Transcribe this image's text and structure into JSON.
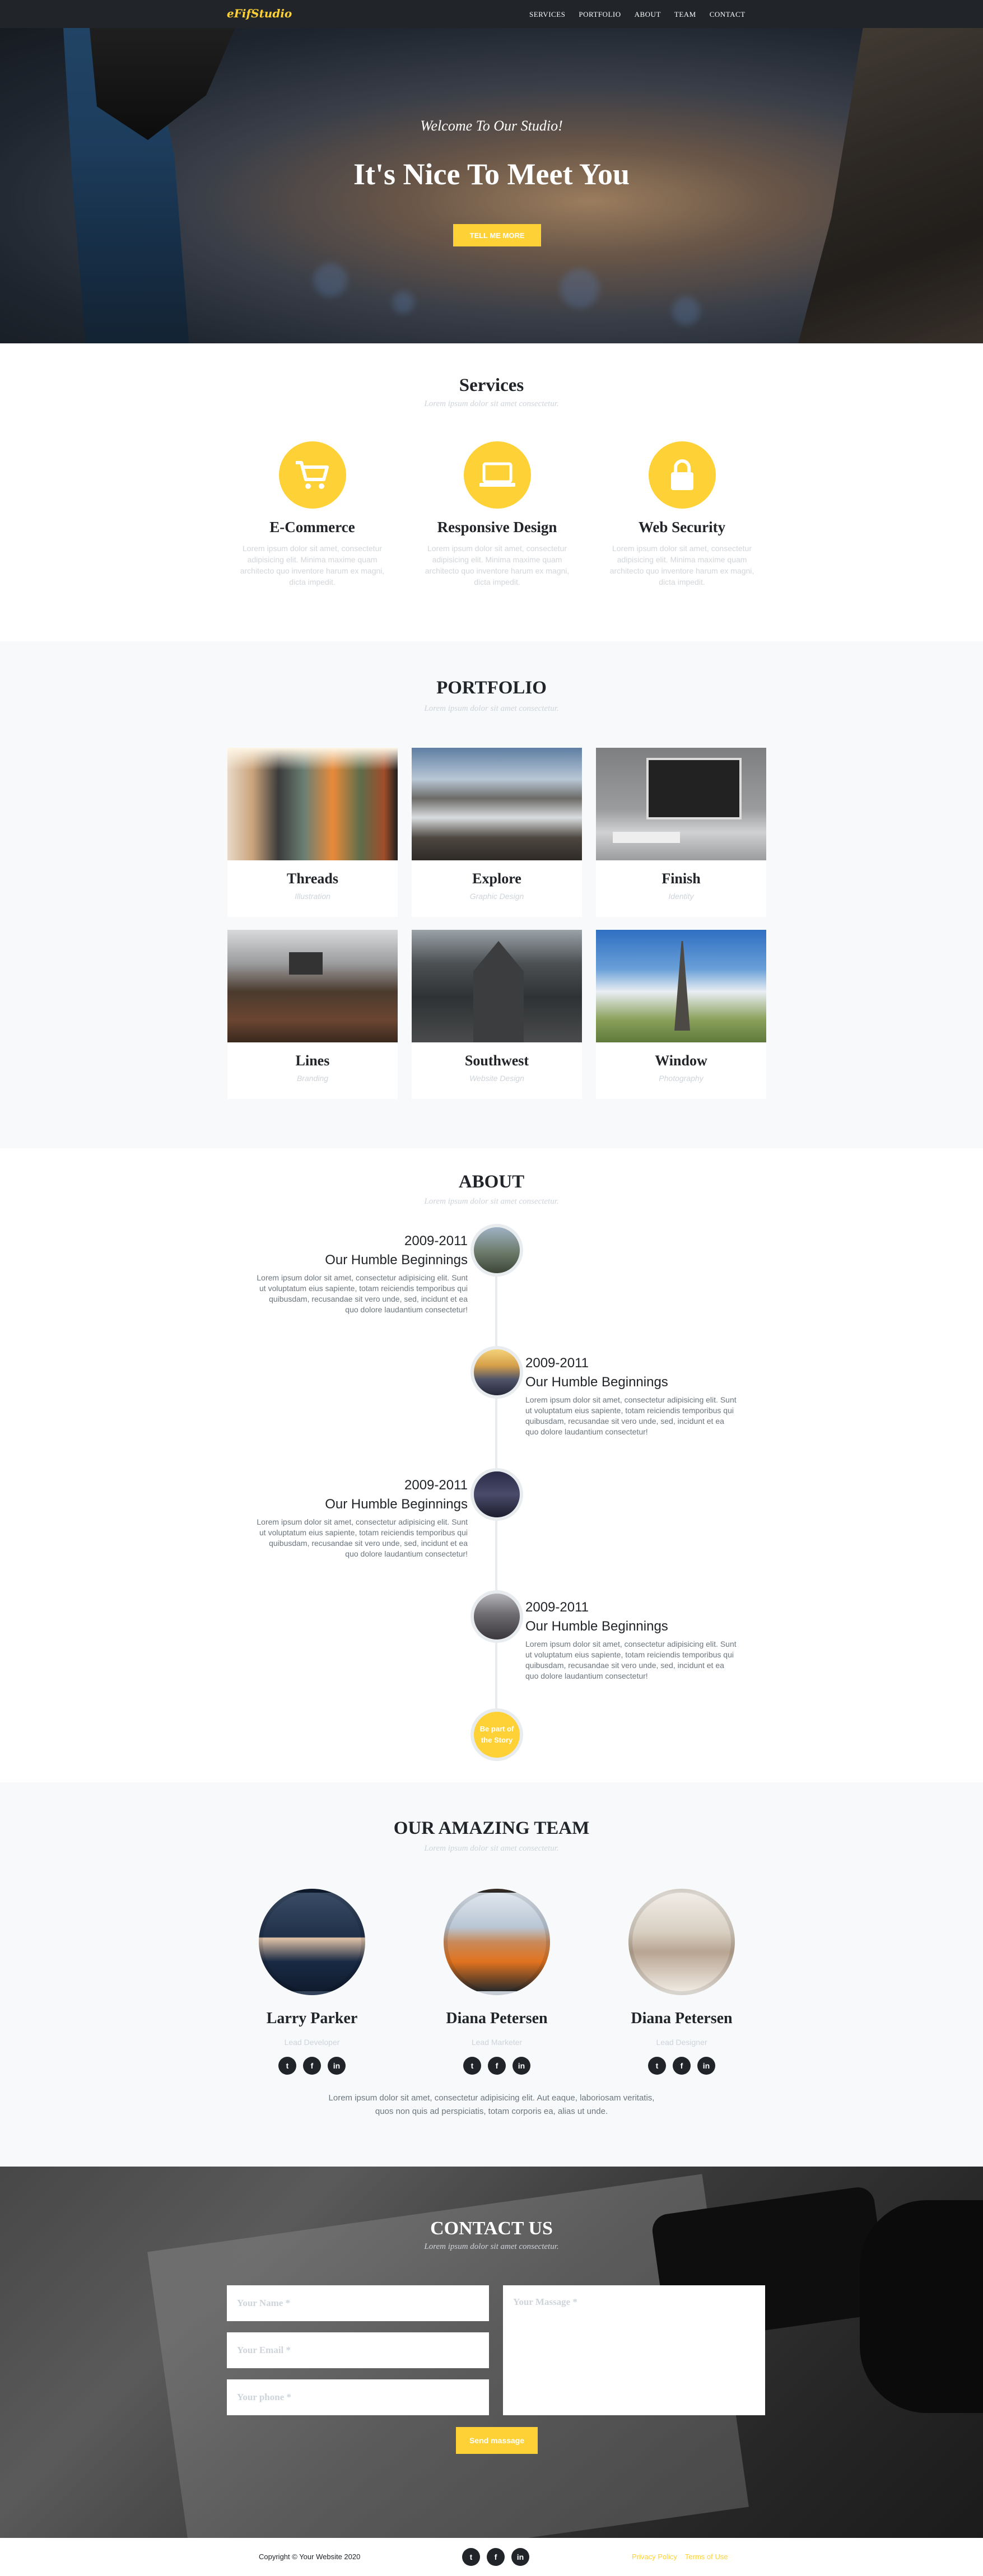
{
  "nav": {
    "brand": "eFifStudio",
    "items": [
      "SERVICES",
      "PORTFOLIO",
      "ABOUT",
      "TEAM",
      "CONTACT"
    ]
  },
  "hero": {
    "subtitle": "Welcome To Our Studio!",
    "title": "It's Nice To Meet You",
    "button": "TELL ME MORE"
  },
  "services": {
    "title": "Services",
    "subtitle": "Lorem ipsum dolor sit amet consectetur.",
    "items": [
      {
        "icon": "shopping-cart-icon",
        "title": "E-Commerce",
        "text": "Lorem ipsum dolor sit amet, consectetur adipisicing elit. Minima maxime quam architecto quo inventore harum ex magni, dicta impedit."
      },
      {
        "icon": "laptop-icon",
        "title": "Responsive Design",
        "text": "Lorem ipsum dolor sit amet, consectetur adipisicing elit. Minima maxime quam architecto quo inventore harum ex magni, dicta impedit."
      },
      {
        "icon": "lock-icon",
        "title": "Web Security",
        "text": "Lorem ipsum dolor sit amet, consectetur adipisicing elit. Minima maxime quam architecto quo inventore harum ex magni, dicta impedit."
      }
    ]
  },
  "portfolio": {
    "title": "PORTFOLIO",
    "subtitle": "Lorem ipsum dolor sit amet consectetur.",
    "items": [
      {
        "title": "Threads",
        "category": "Illustration"
      },
      {
        "title": "Explore",
        "category": "Graphic Design"
      },
      {
        "title": "Finish",
        "category": "Identity"
      },
      {
        "title": "Lines",
        "category": "Branding"
      },
      {
        "title": "Southwest",
        "category": "Website Design"
      },
      {
        "title": "Window",
        "category": "Photography"
      }
    ]
  },
  "about": {
    "title": "ABOUT",
    "subtitle": "Lorem ipsum dolor sit amet consectetur.",
    "items": [
      {
        "year": "2009-2011",
        "heading": "Our Humble Beginnings",
        "text": "Lorem ipsum dolor sit amet, consectetur adipisicing elit. Sunt ut voluptatum eius sapiente, totam reiciendis temporibus qui quibusdam, recusandae sit vero unde, sed, incidunt et ea quo dolore laudantium consectetur!"
      },
      {
        "year": "2009-2011",
        "heading": "Our Humble Beginnings",
        "text": "Lorem ipsum dolor sit amet, consectetur adipisicing elit. Sunt ut voluptatum eius sapiente, totam reiciendis temporibus qui quibusdam, recusandae sit vero unde, sed, incidunt et ea quo dolore laudantium consectetur!"
      },
      {
        "year": "2009-2011",
        "heading": "Our Humble Beginnings",
        "text": "Lorem ipsum dolor sit amet, consectetur adipisicing elit. Sunt ut voluptatum eius sapiente, totam reiciendis temporibus qui quibusdam, recusandae sit vero unde, sed, incidunt et ea quo dolore laudantium consectetur!"
      },
      {
        "year": "2009-2011",
        "heading": "Our Humble Beginnings",
        "text": "Lorem ipsum dolor sit amet, consectetur adipisicing elit. Sunt ut voluptatum eius sapiente, totam reiciendis temporibus qui quibusdam, recusandae sit vero unde, sed, incidunt et ea quo dolore laudantium consectetur!"
      }
    ],
    "story": "Be part of the Story"
  },
  "team": {
    "title": "OUR AMAZING TEAM",
    "subtitle": "Lorem ipsum dolor sit amet consectetur.",
    "members": [
      {
        "name": "Larry Parker",
        "role": "Lead Developer"
      },
      {
        "name": "Diana Petersen",
        "role": "Lead Marketer"
      },
      {
        "name": "Diana Petersen",
        "role": "Lead Designer"
      }
    ],
    "description": "Lorem ipsum dolor sit amet, consectetur adipisicing elit. Aut eaque, laboriosam veritatis, quos non quis ad perspiciatis, totam corporis ea, alias ut unde."
  },
  "contact": {
    "title": "CONTACT US",
    "subtitle": "Lorem ipsum dolor sit amet consectetur.",
    "name_placeholder": "Your Name *",
    "email_placeholder": "Your Email *",
    "phone_placeholder": "Your phone *",
    "message_placeholder": "Your Massage *",
    "send": "Send massage"
  },
  "footer": {
    "copyright": "Copyright © Your Website 2020",
    "privacy": "Privacy Policy",
    "terms": "Terms of Use"
  },
  "social_icons": [
    "t",
    "f",
    "in"
  ],
  "colors": {
    "accent": "#fed136",
    "dark": "#212529"
  }
}
